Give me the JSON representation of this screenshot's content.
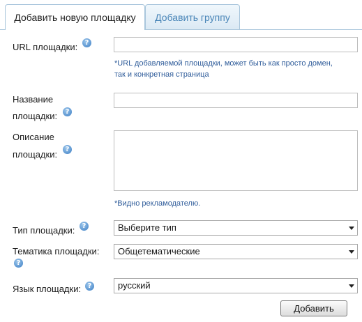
{
  "tabs": [
    {
      "label": "Добавить новую площадку"
    },
    {
      "label": "Добавить группу"
    }
  ],
  "form": {
    "url": {
      "label": "URL площадки:",
      "value": "",
      "hint_line1": "*URL добавляемой площадки, может быть как просто домен,",
      "hint_line2": "так и конкретная страница"
    },
    "name": {
      "label_line1": "Название",
      "label_line2": "площадки:",
      "value": ""
    },
    "description": {
      "label_line1": "Описание",
      "label_line2": "площадки:",
      "value": "",
      "hint": "*Видно рекламодателю."
    },
    "type": {
      "label": "Тип площадки:",
      "selected": "Выберите тип"
    },
    "theme": {
      "label": "Тематика площадки:",
      "selected": "Общетематические"
    },
    "language": {
      "label": "Язык площадки:",
      "selected": "русский"
    },
    "help_glyph": "?",
    "submit_label": "Добавить"
  },
  "colors": {
    "tab_border": "#a9c6dc",
    "inactive_tab_text": "#4a86b8",
    "hint_text": "#2f5c9a",
    "help_icon": "#3b7dc4"
  }
}
